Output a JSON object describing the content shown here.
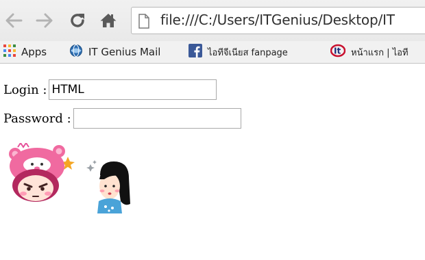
{
  "browser": {
    "address_bar": {
      "url": "file:///C:/Users/ITGenius/Desktop/IT"
    },
    "bookmarks": [
      {
        "label": "Apps",
        "icon": "apps-grid-icon"
      },
      {
        "label": "IT Genius Mail",
        "icon": "mail-globe-icon"
      },
      {
        "label": "ไอทีจีเนียส fanpage",
        "icon": "facebook-icon"
      },
      {
        "label": "หน้าแรก | ไอที",
        "icon": "it-logo-icon"
      }
    ]
  },
  "page": {
    "login": {
      "label": "Login :",
      "value": "HTML"
    },
    "password": {
      "label": "Password :",
      "value": ""
    },
    "stickers": [
      {
        "icon": "pink-bear-hat-girl-sticker"
      },
      {
        "icon": "long-hair-girl-sticker"
      }
    ]
  },
  "colors": {
    "toolbar_bg": "#f1f1f1",
    "address_border": "#b8b8b8",
    "facebook_blue": "#3b5998",
    "sticker_pink": "#f06aa0"
  }
}
